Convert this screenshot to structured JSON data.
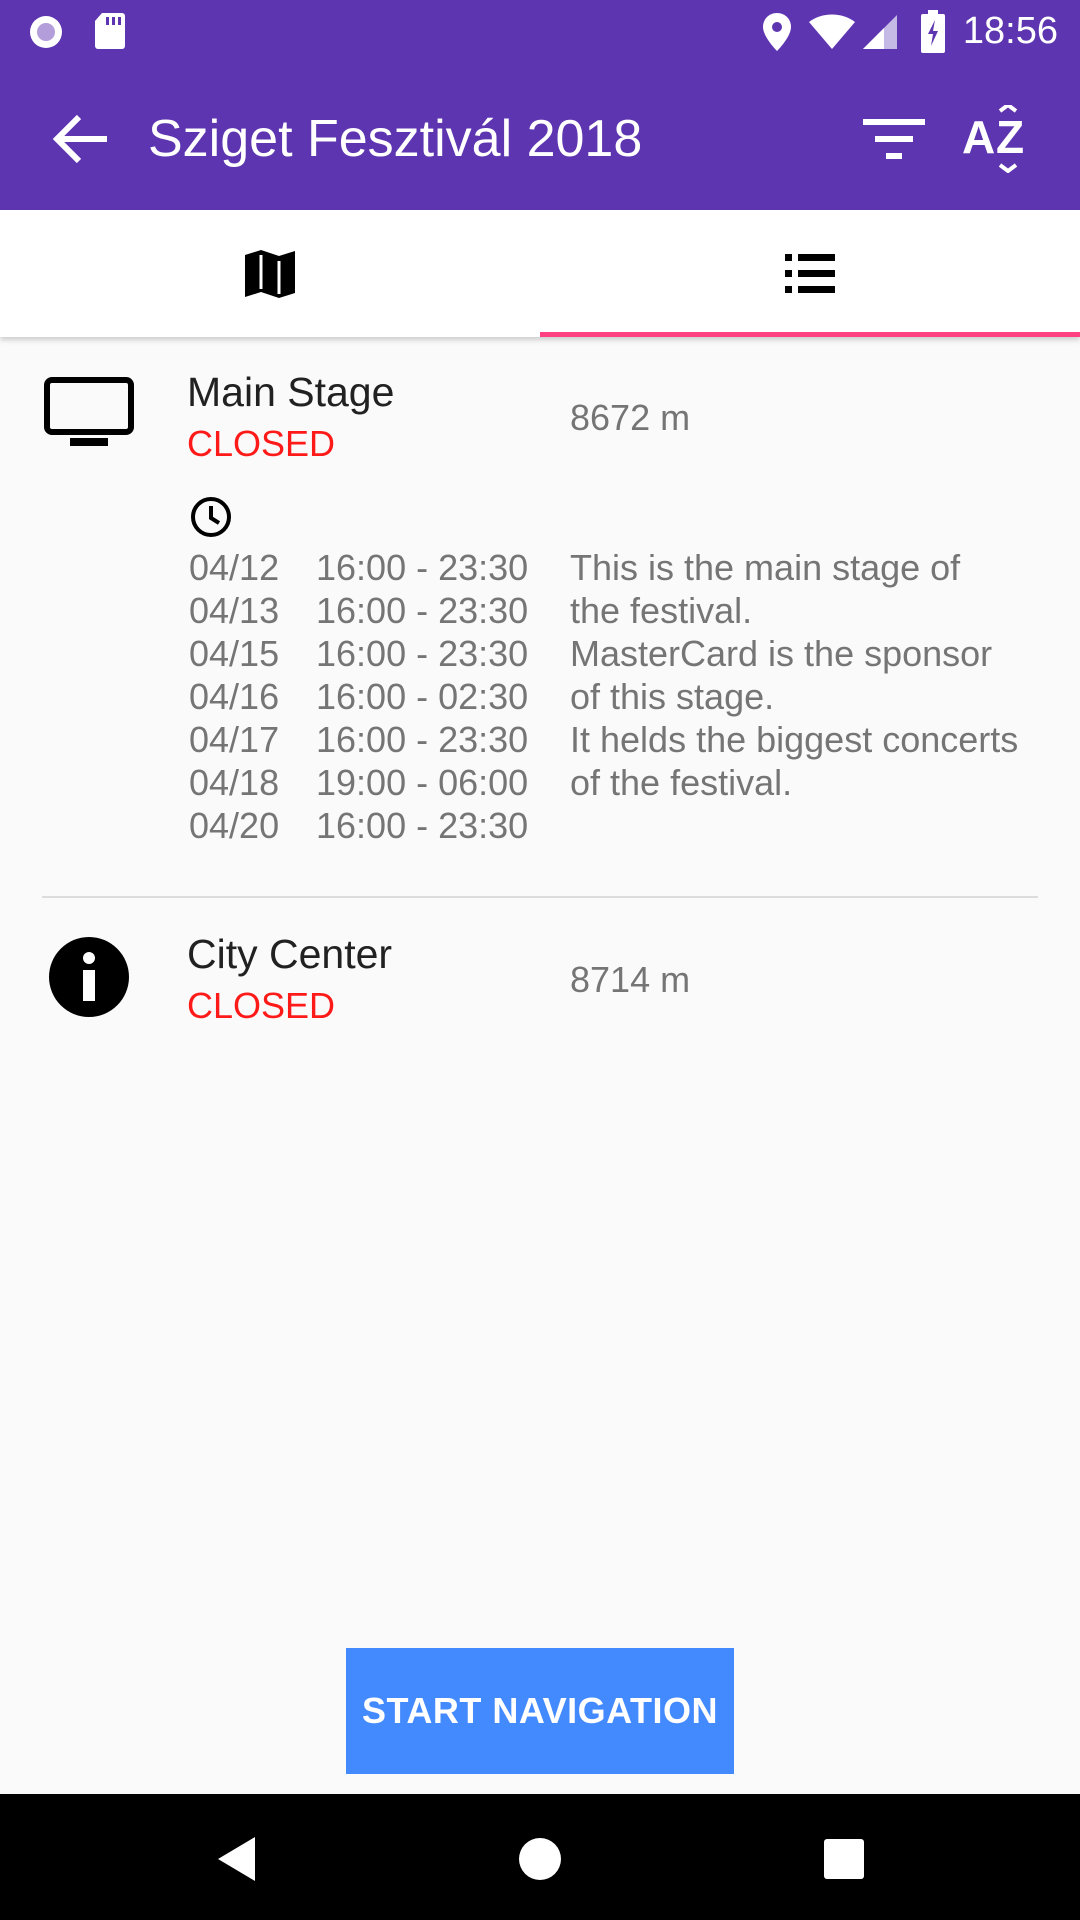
{
  "status_bar": {
    "time": "18:56"
  },
  "app_bar": {
    "title": "Sziget Fesztivál 2018",
    "back_icon": "arrow-back-icon",
    "filter_icon": "filter-icon",
    "sort_icon": "sort-az-icon"
  },
  "tabs": [
    {
      "icon": "map-icon",
      "active": false
    },
    {
      "icon": "list-icon",
      "active": true
    }
  ],
  "places": [
    {
      "icon": "tv-icon",
      "name": "Main Stage",
      "status": "CLOSED",
      "distance": "8672 m",
      "hours": [
        {
          "date": "04/12",
          "time": "16:00 - 23:30"
        },
        {
          "date": "04/13",
          "time": "16:00 - 23:30"
        },
        {
          "date": "04/15",
          "time": "16:00 - 23:30"
        },
        {
          "date": "04/16",
          "time": "16:00 - 02:30"
        },
        {
          "date": "04/17",
          "time": "16:00 - 23:30"
        },
        {
          "date": "04/18",
          "time": "19:00 - 06:00"
        },
        {
          "date": "04/20",
          "time": "16:00 - 23:30"
        }
      ],
      "description": [
        "This is the main stage of",
        "the festival.",
        "MasterCard is the sponsor",
        "of this stage.",
        "It helds the biggest concerts",
        "of the festival."
      ]
    },
    {
      "icon": "info-icon",
      "name": "City Center",
      "status": "CLOSED",
      "distance": "8714 m"
    }
  ],
  "actions": {
    "start_navigation": "START NAVIGATION"
  },
  "colors": {
    "primary": "#5e35b1",
    "accent": "#ff4081",
    "closed": "#ff1a1a",
    "button": "#448aff"
  }
}
